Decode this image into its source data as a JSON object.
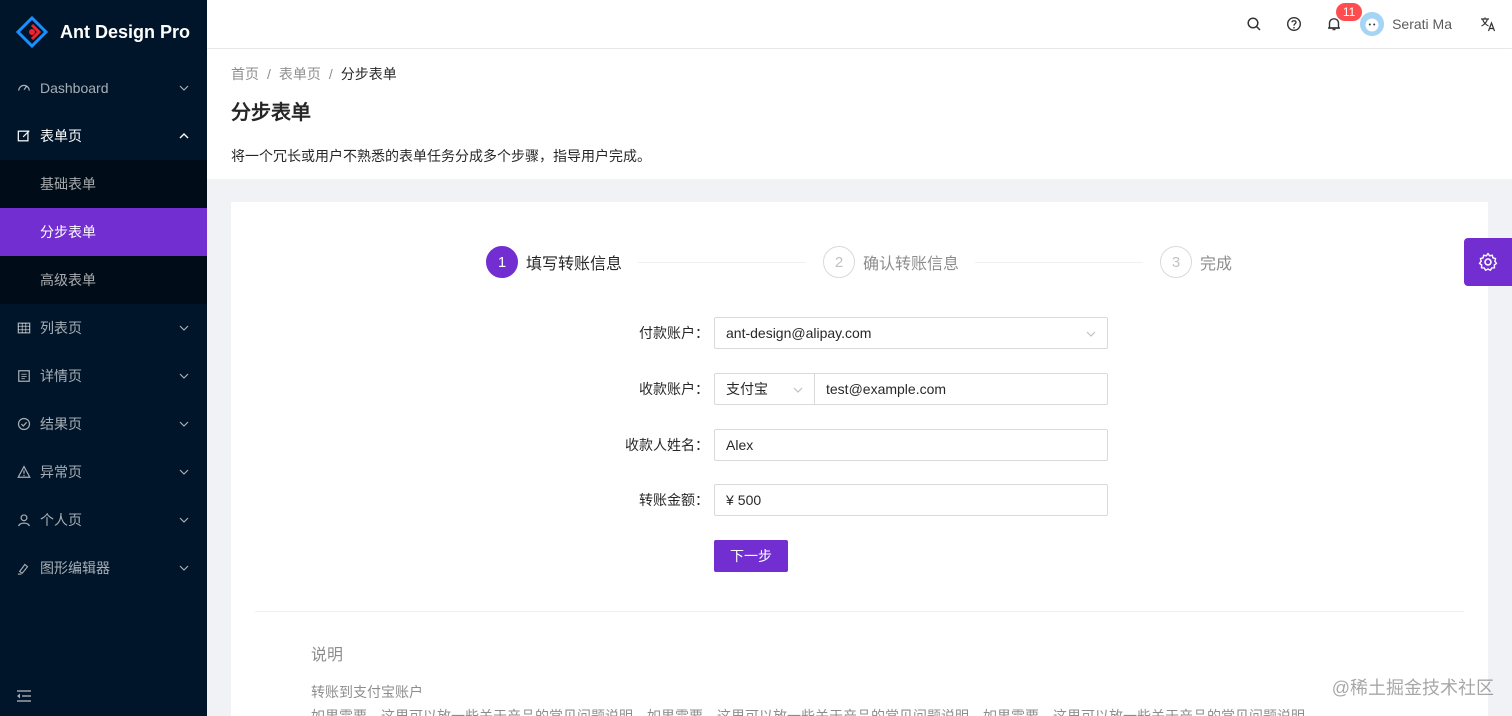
{
  "app": {
    "title": "Ant Design Pro",
    "accent": "#722ed1"
  },
  "sidebar": {
    "items": [
      {
        "label": "Dashboard",
        "icon": "dashboard-icon"
      },
      {
        "label": "表单页",
        "icon": "form-icon",
        "open": true,
        "children": [
          {
            "label": "基础表单"
          },
          {
            "label": "分步表单",
            "active": true
          },
          {
            "label": "高级表单"
          }
        ]
      },
      {
        "label": "列表页",
        "icon": "table-icon"
      },
      {
        "label": "详情页",
        "icon": "profile-icon"
      },
      {
        "label": "结果页",
        "icon": "check-circle-icon"
      },
      {
        "label": "异常页",
        "icon": "warning-icon"
      },
      {
        "label": "个人页",
        "icon": "user-icon"
      },
      {
        "label": "图形编辑器",
        "icon": "highlight-icon"
      }
    ]
  },
  "header": {
    "notification_count": "11",
    "user_name": "Serati Ma"
  },
  "breadcrumb": [
    "首页",
    "表单页",
    "分步表单"
  ],
  "page": {
    "title": "分步表单",
    "description": "将一个冗长或用户不熟悉的表单任务分成多个步骤，指导用户完成。"
  },
  "steps": [
    {
      "num": "1",
      "title": "填写转账信息",
      "active": true
    },
    {
      "num": "2",
      "title": "确认转账信息"
    },
    {
      "num": "3",
      "title": "完成"
    }
  ],
  "form": {
    "pay_account": {
      "label": "付款账户",
      "value": "ant-design@alipay.com"
    },
    "receiver_account": {
      "label": "收款账户",
      "type": "支付宝",
      "value": "test@example.com"
    },
    "receiver_name": {
      "label": "收款人姓名",
      "value": "Alex"
    },
    "amount": {
      "label": "转账金额",
      "prefix": "¥",
      "value": "500"
    },
    "next_label": "下一步"
  },
  "explanation": {
    "title": "说明",
    "subtitle": "转账到支付宝账户",
    "text": "如果需要，这里可以放一些关于产品的常见问题说明。如果需要，这里可以放一些关于产品的常见问题说明。如果需要，这里可以放一些关于产品的常见问题说明。"
  },
  "watermark": "@稀土掘金技术社区"
}
